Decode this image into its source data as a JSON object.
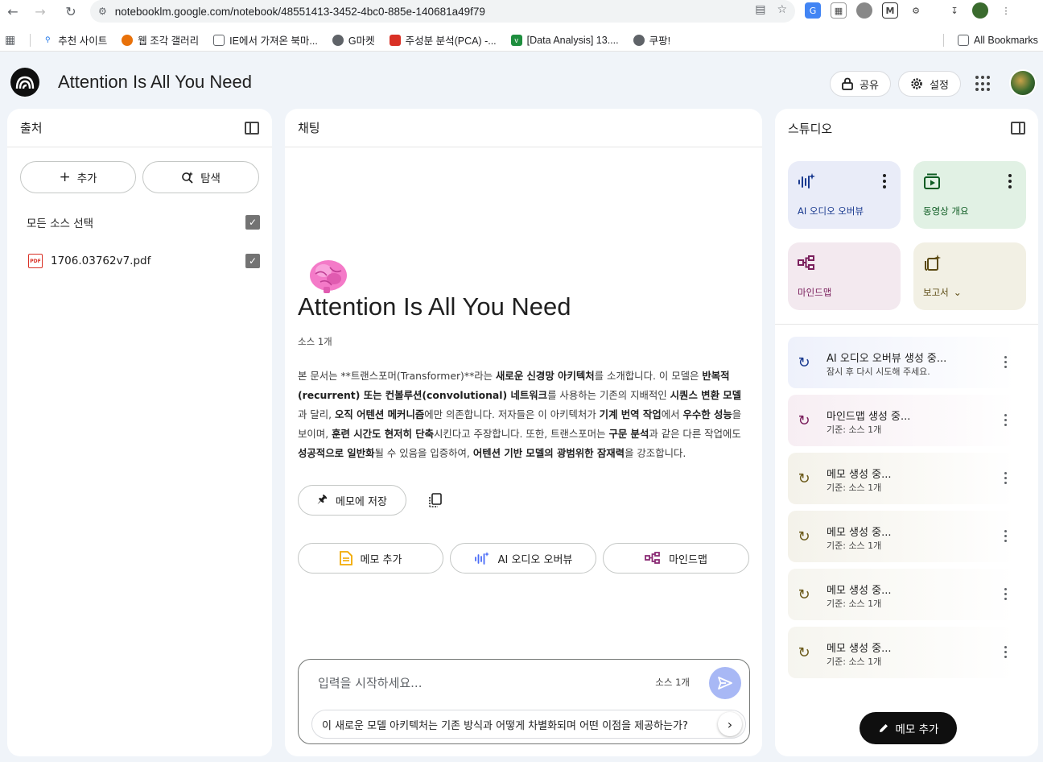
{
  "browser": {
    "url": "notebooklm.google.com/notebook/48551413-3452-4bc0-885e-140681a49f79",
    "bookmarks": [
      {
        "label": "추천 사이트",
        "color": "#1a73e8"
      },
      {
        "label": "웹 조각 갤러리",
        "color": "#e8710a"
      },
      {
        "label": "IE에서 가져온 북마...",
        "color": "#5f6368"
      },
      {
        "label": "G마켓",
        "color": "#5f6368"
      },
      {
        "label": "주성분 분석(PCA) -...",
        "color": "#d93025"
      },
      {
        "label": "[Data Analysis] 13....",
        "color": "#1e8e3e"
      },
      {
        "label": "쿠팡!",
        "color": "#5f6368"
      }
    ],
    "all_bookmarks": "All Bookmarks"
  },
  "header": {
    "title": "Attention Is All You Need",
    "share_label": "공유",
    "settings_label": "설정"
  },
  "sources": {
    "title": "출처",
    "add_label": "추가",
    "explore_label": "탐색",
    "select_all_label": "모든 소스 선택",
    "files": [
      {
        "name": "1706.03762v7.pdf"
      }
    ]
  },
  "chat": {
    "title": "채팅",
    "notebook_title": "Attention Is All You Need",
    "source_count": "소스 1개",
    "save_note_label": "메모에 저장",
    "actions": [
      "메모 추가",
      "AI 오디오 오버뷰",
      "마인드맵"
    ],
    "input_placeholder": "입력을 시작하세요...",
    "input_source_count": "소스 1개",
    "suggestion": "이 새로운 모델 아키텍처는 기존 방식과 어떻게 차별화되며 어떤 이점을 제공하는가?",
    "summary_segments": [
      {
        "t": "본 문서는 **트랜스포머(Transformer)**라는 ",
        "b": false
      },
      {
        "t": "새로운 신경망 아키텍처",
        "b": true
      },
      {
        "t": "를 소개합니다. 이 모델은 ",
        "b": false
      },
      {
        "t": "반복적(recurrent) 또는 컨볼루션(convolutional) 네트워크",
        "b": true
      },
      {
        "t": "를 사용하는 기존의 지배적인 ",
        "b": false
      },
      {
        "t": "시퀀스 변환 모델",
        "b": true
      },
      {
        "t": "과 달리, ",
        "b": false
      },
      {
        "t": "오직 어텐션 메커니즘",
        "b": true
      },
      {
        "t": "에만 의존합니다. 저자들은 이 아키텍처가 ",
        "b": false
      },
      {
        "t": "기계 번역 작업",
        "b": true
      },
      {
        "t": "에서 ",
        "b": false
      },
      {
        "t": "우수한 성능",
        "b": true
      },
      {
        "t": "을 보이며, ",
        "b": false
      },
      {
        "t": "훈련 시간도 현저히 단축",
        "b": true
      },
      {
        "t": "시킨다고 주장합니다. 또한, 트랜스포머는 ",
        "b": false
      },
      {
        "t": "구문 분석",
        "b": true
      },
      {
        "t": "과 같은 다른 작업에도 ",
        "b": false
      },
      {
        "t": "성공적으로 일반화",
        "b": true
      },
      {
        "t": "될 수 있음을 입증하여, ",
        "b": false
      },
      {
        "t": "어텐션 기반 모델의 광범위한 잠재력",
        "b": true
      },
      {
        "t": "을 강조합니다.",
        "b": false
      }
    ]
  },
  "studio": {
    "title": "스튜디오",
    "tiles": [
      {
        "label": "AI 오디오 오버뷰",
        "bg": "#e9ecf8",
        "color": "#1a3a8f",
        "icon": "audio-waveform-icon"
      },
      {
        "label": "동영상 개요",
        "bg": "#e1f1e4",
        "color": "#0d5c22",
        "icon": "video-icon"
      },
      {
        "label": "마인드맵",
        "bg": "#f3e9ef",
        "color": "#7a1f5c",
        "icon": "mindmap-icon"
      },
      {
        "label": "보고서",
        "bg": "#f2f0e4",
        "color": "#5b4a12",
        "icon": "report-icon"
      }
    ],
    "generating": [
      {
        "title": "AI 오디오 오버뷰 생성 중...",
        "sub": "잠시 후 다시 시도해 주세요.",
        "color": "#1a3a8f",
        "bg": "#eef1fb"
      },
      {
        "title": "마인드맵 생성 중...",
        "sub": "기준: 소스 1개",
        "color": "#7a1f5c",
        "bg": "#f7eef3"
      },
      {
        "title": "메모 생성 중...",
        "sub": "기준: 소스 1개",
        "color": "#6b5a1a",
        "bg": "#f4f2ea"
      },
      {
        "title": "메모 생성 중...",
        "sub": "기준: 소스 1개",
        "color": "#6b5a1a",
        "bg": "#f4f2ea"
      },
      {
        "title": "메모 생성 중...",
        "sub": "기준: 소스 1개",
        "color": "#6b5a1a",
        "bg": "#f6f5ef"
      },
      {
        "title": "메모 생성 중...",
        "sub": "기준: 소스 1개",
        "color": "#6b5a1a",
        "bg": "#f6f5ef"
      }
    ],
    "add_note_label": "메모 추가"
  }
}
